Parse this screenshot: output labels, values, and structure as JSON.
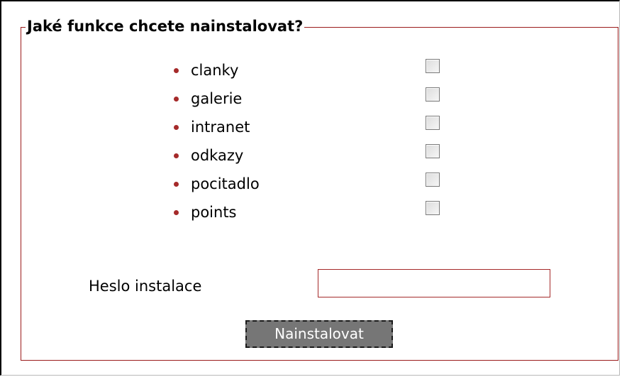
{
  "form": {
    "legend": "Jaké funkce chcete nainstalovat?",
    "features": [
      {
        "label": "clanky",
        "checked": false
      },
      {
        "label": "galerie",
        "checked": false
      },
      {
        "label": "intranet",
        "checked": false
      },
      {
        "label": "odkazy",
        "checked": false
      },
      {
        "label": "pocitadlo",
        "checked": false
      },
      {
        "label": "points",
        "checked": false
      }
    ],
    "password_label": "Heslo instalace",
    "password_value": "",
    "submit_label": "Nainstalovat"
  },
  "colors": {
    "accent": "#a52a2a",
    "button_bg": "#767676",
    "button_text": "#ffffff"
  }
}
